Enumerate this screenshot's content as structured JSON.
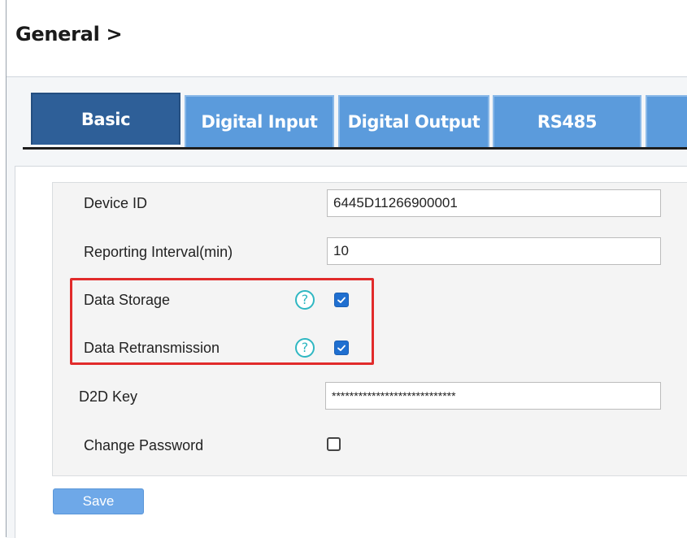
{
  "header": {
    "title": "General >"
  },
  "tabs": [
    {
      "label": "Basic",
      "active": true
    },
    {
      "label": "Digital Input",
      "active": false
    },
    {
      "label": "Digital Output",
      "active": false
    },
    {
      "label": "RS485",
      "active": false
    },
    {
      "label": "",
      "active": false
    }
  ],
  "form": {
    "device_id": {
      "label": "Device ID",
      "value": "6445D11266900001"
    },
    "reporting_interval": {
      "label": "Reporting Interval(min)",
      "value": "10"
    },
    "data_storage": {
      "label": "Data Storage",
      "help_icon": "?",
      "checked": true
    },
    "data_retransmission": {
      "label": "Data Retransmission",
      "help_icon": "?",
      "checked": true
    },
    "d2d_key": {
      "label": "D2D Key",
      "value": "****************************"
    },
    "change_password": {
      "label": "Change Password",
      "checked": false
    }
  },
  "actions": {
    "save_label": "Save"
  },
  "colors": {
    "tab_active": "#2e5f98",
    "tab_inactive": "#5b9bdc",
    "checkbox_checked": "#1f6fd0",
    "help_icon": "#2fb7c2",
    "highlight_box": "#e12b2b",
    "save_button": "#6ea8e8"
  },
  "icons": {
    "help": "help-icon",
    "checkbox": "checkbox-icon"
  }
}
